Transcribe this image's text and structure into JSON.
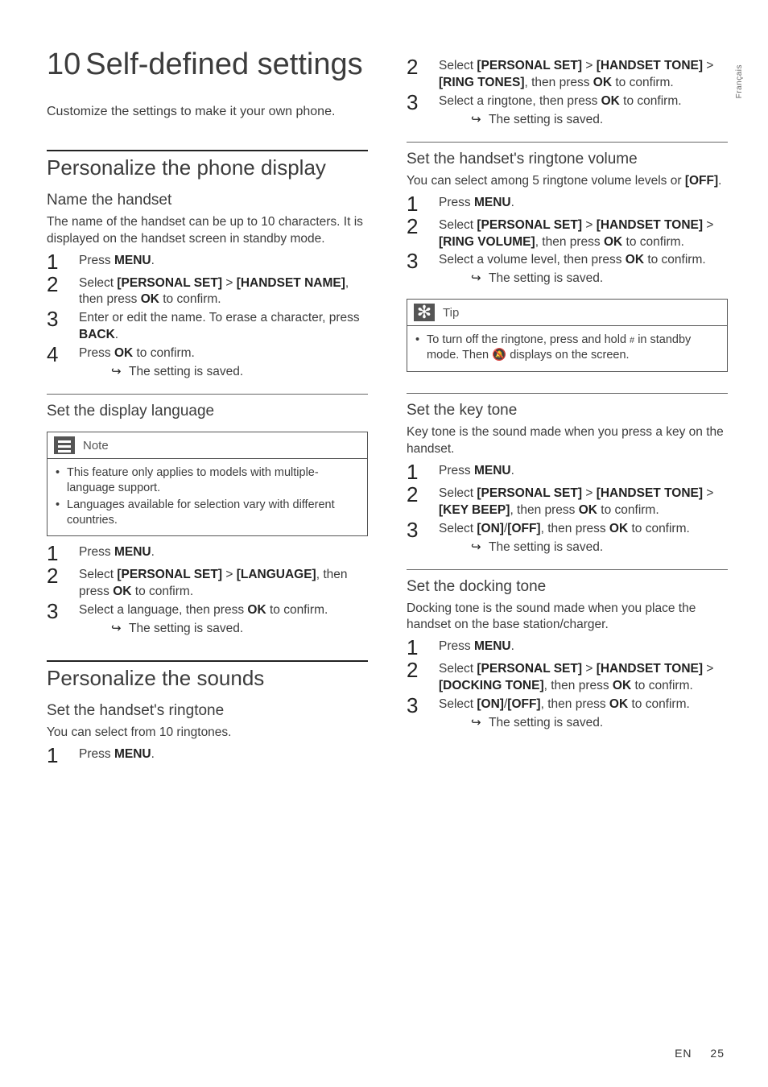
{
  "side_tab": "Français",
  "chapter": {
    "number": "10",
    "title": "Self-defined settings"
  },
  "intro": "Customize the settings to make it your own phone.",
  "s1": {
    "heading": "Personalize the phone display",
    "name_handset": {
      "title": "Name the handset",
      "lead": "The name of the handset can be up to 10 characters. It is displayed on the handset screen in standby mode.",
      "step1_a": "Press ",
      "step1_b": "MENU",
      "step1_c": ".",
      "step2_a": "Select ",
      "step2_b": "[PERSONAL SET]",
      "step2_c": " > ",
      "step2_d": "[HANDSET NAME]",
      "step2_e": ", then press ",
      "step2_f": "OK",
      "step2_g": " to confirm.",
      "step3_a": "Enter or edit the name. To erase a character, press ",
      "step3_b": "BACK",
      "step3_c": ".",
      "step4_a": "Press ",
      "step4_b": "OK",
      "step4_c": " to confirm.",
      "result": "The setting is saved."
    },
    "display_lang": {
      "title": "Set the display language",
      "note_label": "Note",
      "note1": "This feature only applies to models with multiple-language support.",
      "note2": "Languages available for selection vary with different countries.",
      "step1_a": "Press ",
      "step1_b": "MENU",
      "step1_c": ".",
      "step2_a": "Select ",
      "step2_b": "[PERSONAL SET]",
      "step2_c": " > ",
      "step2_d": "[LANGUAGE]",
      "step2_e": ", then press ",
      "step2_f": "OK",
      "step2_g": " to confirm.",
      "step3_a": "Select a language, then press ",
      "step3_b": "OK",
      "step3_c": " to confirm.",
      "result": "The setting is saved."
    }
  },
  "s2": {
    "heading": "Personalize the sounds",
    "ringtone": {
      "title": "Set the handset's ringtone",
      "lead": "You can select from 10 ringtones.",
      "step1_a": "Press ",
      "step1_b": "MENU",
      "step1_c": ".",
      "step2_a": "Select ",
      "step2_b": "[PERSONAL SET]",
      "step2_c": " > ",
      "step2_d": "[HANDSET TONE]",
      "step2_e": " > ",
      "step2_f": "[RING TONES]",
      "step2_g": ", then press ",
      "step2_h": "OK",
      "step2_i": " to confirm.",
      "step3_a": "Select a ringtone, then press ",
      "step3_b": "OK",
      "step3_c": " to confirm.",
      "result": "The setting is saved."
    },
    "ring_vol": {
      "title": "Set the handset's ringtone volume",
      "lead_a": "You can select among 5 ringtone volume levels or ",
      "lead_b": "[OFF]",
      "lead_c": ".",
      "step1_a": "Press ",
      "step1_b": "MENU",
      "step1_c": ".",
      "step2_a": "Select ",
      "step2_b": "[PERSONAL SET]",
      "step2_c": " > ",
      "step2_d": "[HANDSET TONE]",
      "step2_e": " >",
      "step2_f": "[RING VOLUME]",
      "step2_g": ", then press ",
      "step2_h": "OK",
      "step2_i": " to confirm.",
      "step3_a": "Select a volume level, then press ",
      "step3_b": "OK",
      "step3_c": " to confirm.",
      "result": "The setting is saved.",
      "tip_label": "Tip",
      "tip_text_a": "To turn off the ringtone, press and hold ",
      "tip_text_b": " in standby mode. Then ",
      "tip_text_c": " displays on the screen."
    },
    "key_tone": {
      "title": "Set the key tone",
      "lead": "Key tone is the sound made when you press a key on the handset.",
      "step1_a": "Press ",
      "step1_b": "MENU",
      "step1_c": ".",
      "step2_a": "Select ",
      "step2_b": "[PERSONAL SET]",
      "step2_c": " > ",
      "step2_d": "[HANDSET TONE]",
      "step2_e": " > ",
      "step2_f": "[KEY BEEP]",
      "step2_g": ", then press ",
      "step2_h": "OK",
      "step2_i": " to confirm.",
      "step3_a": "Select ",
      "step3_b": "[ON]",
      "step3_c": "/",
      "step3_d": "[OFF]",
      "step3_e": ", then press ",
      "step3_f": "OK",
      "step3_g": " to confirm.",
      "result": "The setting is saved."
    },
    "dock_tone": {
      "title": "Set the docking tone",
      "lead": "Docking tone is the sound made when you place the handset on the base station/charger.",
      "step1_a": "Press ",
      "step1_b": "MENU",
      "step1_c": ".",
      "step2_a": "Select ",
      "step2_b": "[PERSONAL SET]",
      "step2_c": " > ",
      "step2_d": "[HANDSET TONE]",
      "step2_e": " >",
      "step2_f": "[DOCKING TONE]",
      "step2_g": ", then press ",
      "step2_h": "OK",
      "step2_i": " to confirm.",
      "step3_a": "Select ",
      "step3_b": "[ON]",
      "step3_c": "/",
      "step3_d": "[OFF]",
      "step3_e": ", then press ",
      "step3_f": "OK",
      "step3_g": " to confirm.",
      "result": "The setting is saved."
    }
  },
  "footer": {
    "lang": "EN",
    "page": "25"
  }
}
